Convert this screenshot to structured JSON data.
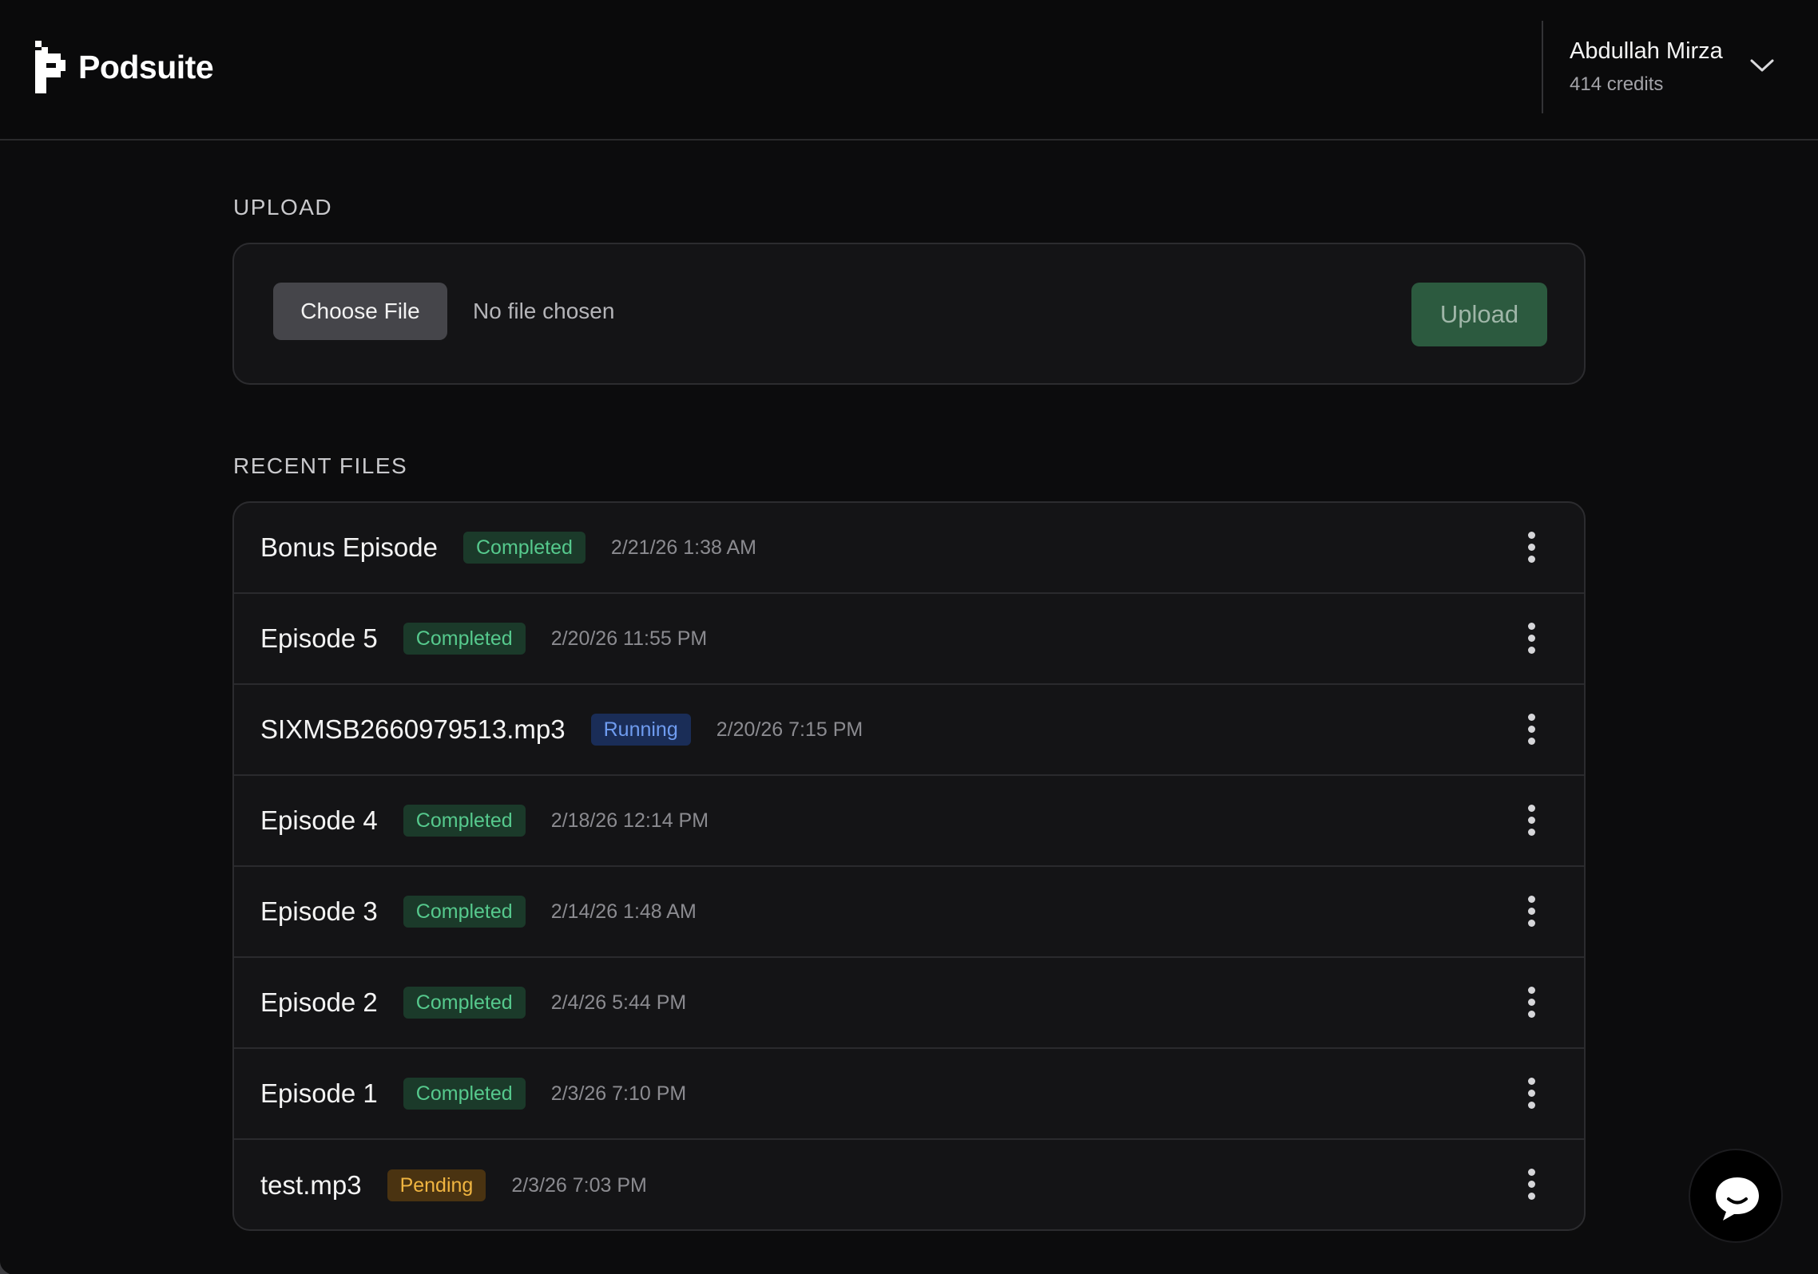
{
  "header": {
    "brand": "Podsuite",
    "user_name": "Abdullah Mirza",
    "credits": "414 credits"
  },
  "upload": {
    "section_label": "UPLOAD",
    "choose_file_label": "Choose File",
    "no_file_text": "No file chosen",
    "upload_label": "Upload"
  },
  "recent": {
    "section_label": "RECENT FILES",
    "files": [
      {
        "name": "Bonus Episode",
        "status": "Completed",
        "date": "2/21/26 1:38 AM"
      },
      {
        "name": "Episode 5",
        "status": "Completed",
        "date": "2/20/26 11:55 PM"
      },
      {
        "name": "SIXMSB2660979513.mp3",
        "status": "Running",
        "date": "2/20/26 7:15 PM"
      },
      {
        "name": "Episode 4",
        "status": "Completed",
        "date": "2/18/26 12:14 PM"
      },
      {
        "name": "Episode 3",
        "status": "Completed",
        "date": "2/14/26 1:48 AM"
      },
      {
        "name": "Episode 2",
        "status": "Completed",
        "date": "2/4/26 5:44 PM"
      },
      {
        "name": "Episode 1",
        "status": "Completed",
        "date": "2/3/26 7:10 PM"
      },
      {
        "name": "test.mp3",
        "status": "Pending",
        "date": "2/3/26 7:03 PM"
      }
    ]
  },
  "colors": {
    "background": "#0c0c0d",
    "card": "#141416",
    "completed": "#56c98d",
    "running": "#6f9cf0",
    "pending": "#f0b541",
    "upload_button": "#2c5a3f"
  },
  "icons": {
    "brand": "podsuite-logo-icon",
    "user_menu": "chevron-down-icon",
    "row_menu": "more-vertical-icon",
    "chat": "chat-bubble-icon"
  }
}
